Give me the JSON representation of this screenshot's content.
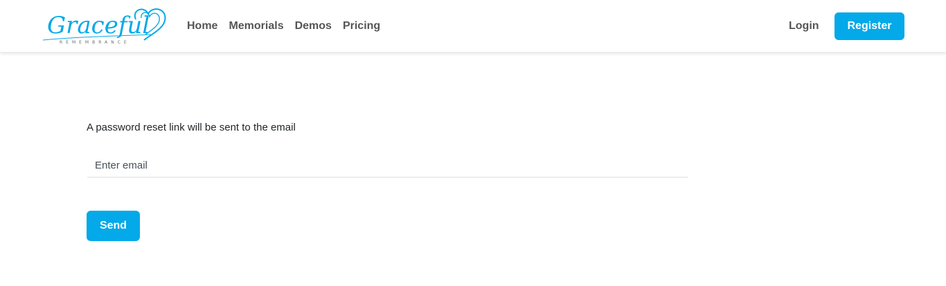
{
  "brand": {
    "name": "Graceful",
    "tagline": "REMEMBRANCE",
    "color": "#03a9e8"
  },
  "nav": {
    "links": [
      "Home",
      "Memorials",
      "Demos",
      "Pricing"
    ],
    "login_label": "Login",
    "register_label": "Register"
  },
  "reset": {
    "message": "A password reset link will be sent to the email",
    "email_placeholder": "Enter email",
    "email_value": "",
    "send_label": "Send"
  },
  "colors": {
    "accent": "#03a9e8",
    "nav_text": "#555555",
    "body_text": "#212529"
  }
}
